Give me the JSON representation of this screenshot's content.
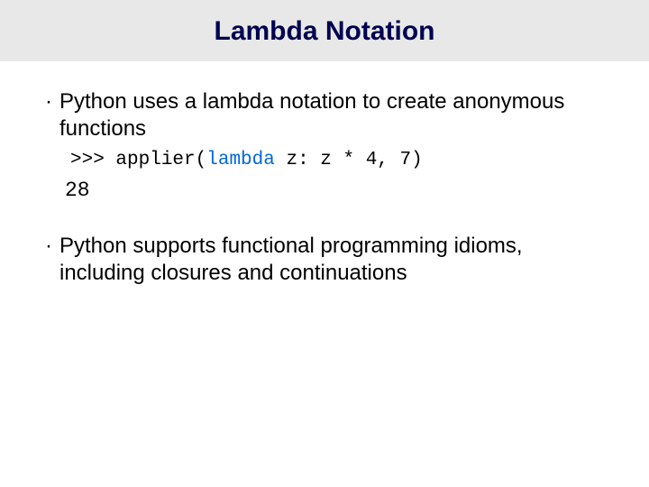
{
  "title": "Lambda Notation",
  "bullets": [
    {
      "text": "Python uses a lambda notation to create anonymous functions",
      "code": {
        "prompt": ">>> ",
        "call_pre": "applier(",
        "lambda_kw": "lambda",
        "lambda_rest": " z: z * 4, 7)",
        "output": "28"
      }
    },
    {
      "text": "Python supports functional programming idioms, including closures and continuations"
    }
  ]
}
